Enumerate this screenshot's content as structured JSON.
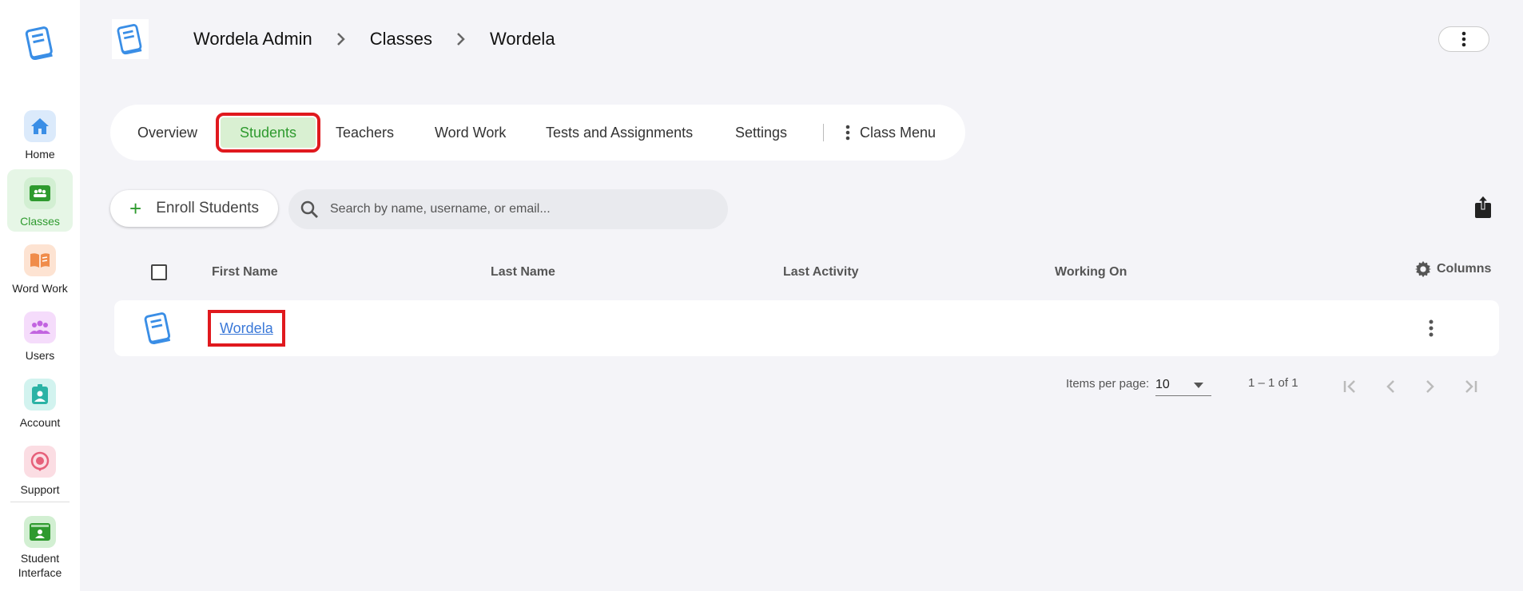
{
  "sidebar": {
    "logo_icon": "book-logo-icon",
    "items": [
      {
        "label": "Home",
        "icon": "home-icon",
        "color": "#3a8ee6",
        "bg": "#dbeafb"
      },
      {
        "label": "Classes",
        "icon": "classroom-icon",
        "color": "#2e9a2e",
        "bg": "#d2efd2",
        "active": true
      },
      {
        "label": "Word Work",
        "icon": "open-book-icon",
        "color": "#f08c4a",
        "bg": "#fde3d2"
      },
      {
        "label": "Users",
        "icon": "users-icon",
        "color": "#c264e0",
        "bg": "#f5dcfb"
      },
      {
        "label": "Account",
        "icon": "id-badge-icon",
        "color": "#2bb3a5",
        "bg": "#d2f3ef"
      },
      {
        "label": "Support",
        "icon": "support-icon",
        "color": "#e6607a",
        "bg": "#fbdde3"
      },
      {
        "label_line1": "Student",
        "label_line2": "Interface",
        "icon": "student-screen-icon",
        "color": "#2e9a2e",
        "bg": "#d2efd2"
      }
    ]
  },
  "header": {
    "breadcrumb": [
      "Wordela Admin",
      "Classes",
      "Wordela"
    ]
  },
  "tabs": {
    "items": [
      "Overview",
      "Students",
      "Teachers",
      "Word Work",
      "Tests and Assignments",
      "Settings"
    ],
    "active": "Students",
    "class_menu_label": "Class Menu"
  },
  "toolbar": {
    "enroll_label": "Enroll Students",
    "search_placeholder": "Search by name, username, or email..."
  },
  "table": {
    "columns": [
      "First Name",
      "Last Name",
      "Last Activity",
      "Working On"
    ],
    "columns_button_label": "Columns",
    "rows": [
      {
        "first_name": "Wordela",
        "last_name": "",
        "last_activity": "",
        "working_on": ""
      }
    ]
  },
  "pagination": {
    "items_per_page_label": "Items per page:",
    "items_per_page": "10",
    "range": "1 – 1 of 1"
  },
  "colors": {
    "accent_green": "#2e9a2e",
    "highlight_red": "#e0191e",
    "link_blue": "#3a78d8",
    "background": "#f4f4f8"
  }
}
